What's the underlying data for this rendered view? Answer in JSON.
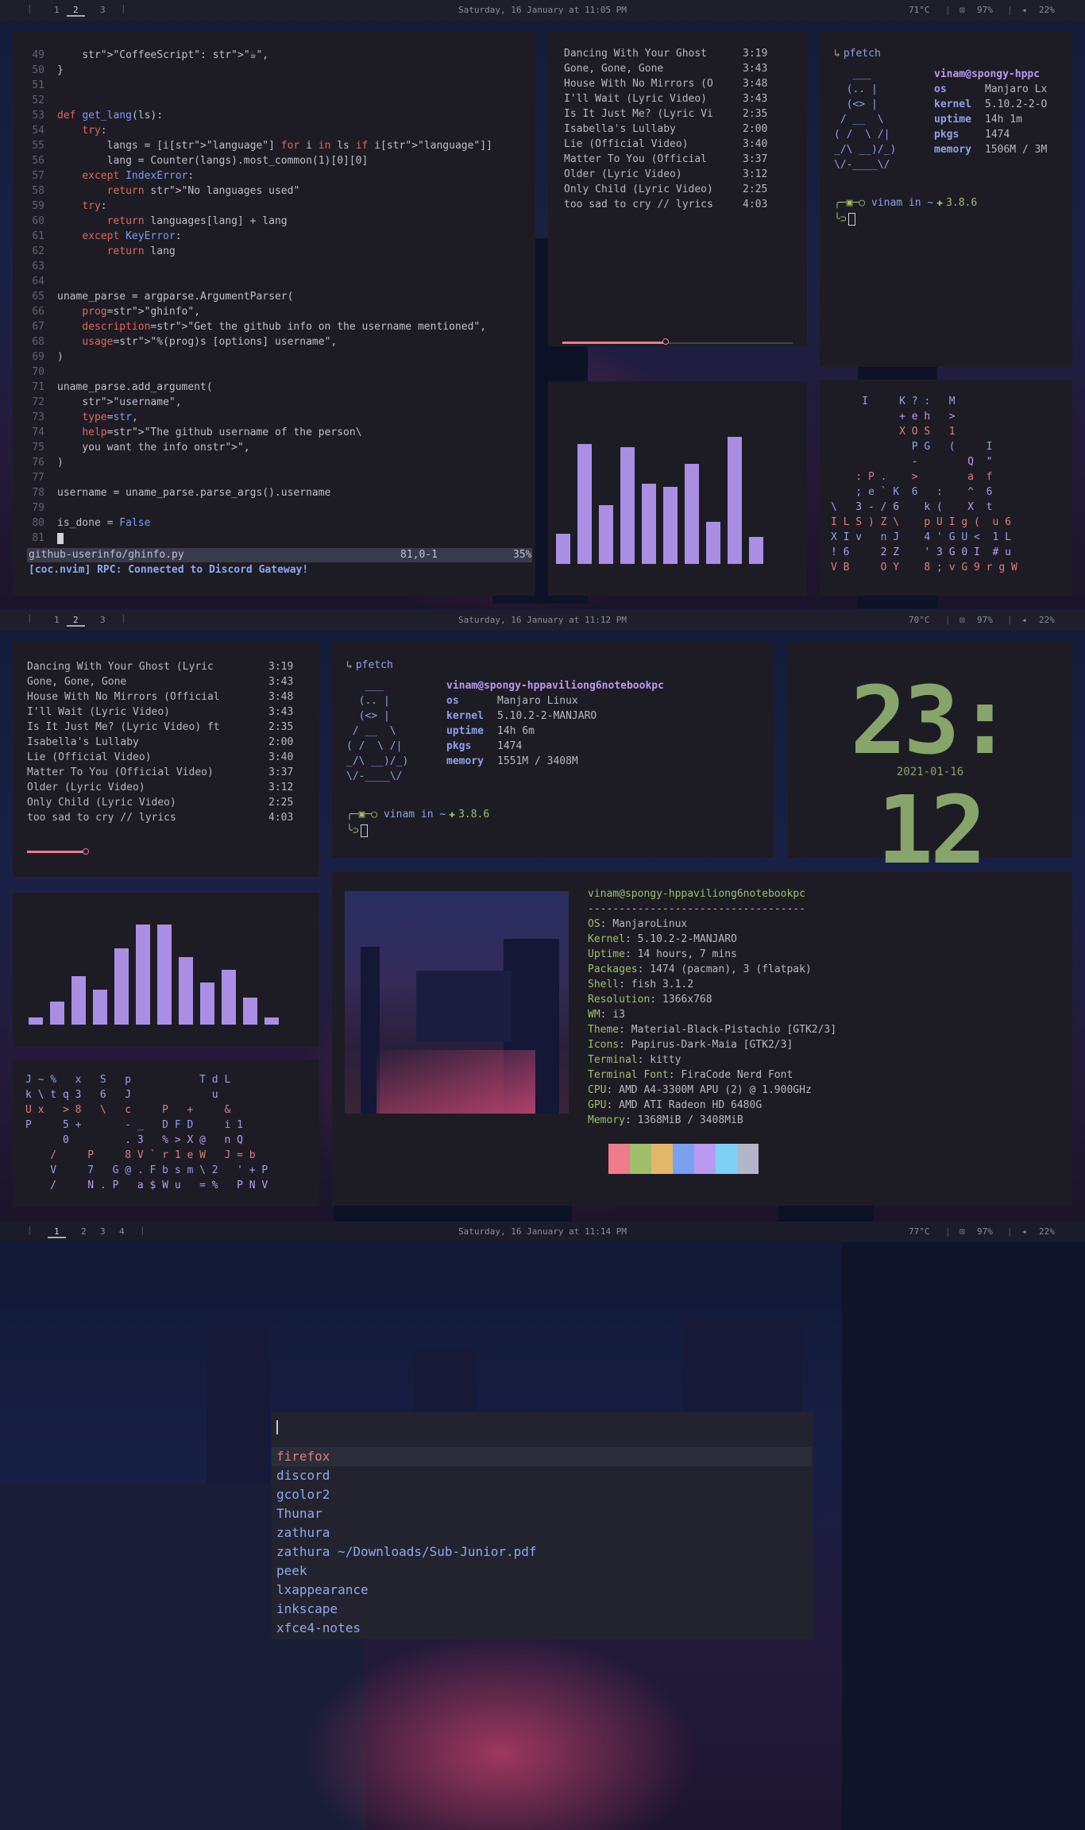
{
  "bars": [
    {
      "workspaces": [
        "1",
        "2",
        "3"
      ],
      "active": "2",
      "clock": "Saturday, 16 January at 11:05 PM",
      "temp": "71°C",
      "battery": "97%",
      "volume": "22%"
    },
    {
      "workspaces": [
        "1",
        "2",
        "3"
      ],
      "active": "2",
      "clock": "Saturday, 16 January at 11:12 PM",
      "temp": "70°C",
      "battery": "97%",
      "volume": "22%"
    },
    {
      "workspaces": [
        "1",
        "2",
        "3",
        "4"
      ],
      "active": "1",
      "clock": "Saturday, 16 January at 11:14 PM",
      "temp": "77°C",
      "battery": "97%",
      "volume": "22%"
    }
  ],
  "editor": {
    "statusline_file": "github-userinfo/ghinfo.py",
    "statusline_pos": "81,0-1",
    "statusline_pct": "35%",
    "message": "[coc.nvim] RPC: Connected to Discord Gateway!",
    "lines": [
      {
        "n": "49",
        "t": "    \"CoffeeScript\": \"☕\","
      },
      {
        "n": "50",
        "t": "}"
      },
      {
        "n": "51",
        "t": ""
      },
      {
        "n": "52",
        "t": ""
      },
      {
        "n": "53",
        "t": "def get_lang(ls):"
      },
      {
        "n": "54",
        "t": "    try:"
      },
      {
        "n": "55",
        "t": "        langs = [i[\"language\"] for i in ls if i[\"language\"]]"
      },
      {
        "n": "56",
        "t": "        lang = Counter(langs).most_common(1)[0][0]"
      },
      {
        "n": "57",
        "t": "    except IndexError:"
      },
      {
        "n": "58",
        "t": "        return \"No languages used\""
      },
      {
        "n": "59",
        "t": "    try:"
      },
      {
        "n": "60",
        "t": "        return languages[lang] + lang"
      },
      {
        "n": "61",
        "t": "    except KeyError:"
      },
      {
        "n": "62",
        "t": "        return lang"
      },
      {
        "n": "63",
        "t": ""
      },
      {
        "n": "64",
        "t": ""
      },
      {
        "n": "65",
        "t": "uname_parse = argparse.ArgumentParser("
      },
      {
        "n": "66",
        "t": "    prog=\"ghinfo\","
      },
      {
        "n": "67",
        "t": "    description=\"Get the github info on the username mentioned\","
      },
      {
        "n": "68",
        "t": "    usage=\"%(prog)s [options] username\","
      },
      {
        "n": "69",
        "t": ")"
      },
      {
        "n": "70",
        "t": ""
      },
      {
        "n": "71",
        "t": "uname_parse.add_argument("
      },
      {
        "n": "72",
        "t": "    \"username\","
      },
      {
        "n": "73",
        "t": "    type=str,"
      },
      {
        "n": "74",
        "t": "    help=\"The github username of the person\\"
      },
      {
        "n": "75",
        "t": "    you want the info on\","
      },
      {
        "n": "76",
        "t": ")"
      },
      {
        "n": "77",
        "t": ""
      },
      {
        "n": "78",
        "t": "username = uname_parse.parse_args().username"
      },
      {
        "n": "79",
        "t": ""
      },
      {
        "n": "80",
        "t": "is_done = False"
      },
      {
        "n": "81",
        "t": ""
      }
    ]
  },
  "playlist_short": [
    {
      "title": "Dancing With Your Ghost",
      "dur": "3:19"
    },
    {
      "title": "Gone, Gone, Gone",
      "dur": "3:43"
    },
    {
      "title": "House With No Mirrors (O",
      "dur": "3:48"
    },
    {
      "title": "I'll Wait (Lyric Video)",
      "dur": "3:43"
    },
    {
      "title": "Is It Just Me? (Lyric Vi",
      "dur": "2:35"
    },
    {
      "title": "Isabella's Lullaby",
      "dur": "2:00"
    },
    {
      "title": "Lie (Official Video)",
      "dur": "3:40"
    },
    {
      "title": "Matter To You (Official",
      "dur": "3:37"
    },
    {
      "title": "Older (Lyric Video)",
      "dur": "3:12"
    },
    {
      "title": "Only Child (Lyric Video)",
      "dur": "2:25"
    },
    {
      "title": "too sad to cry // lyrics",
      "dur": "4:03"
    }
  ],
  "playlist_long": [
    {
      "title": "Dancing With Your Ghost (Lyric",
      "dur": "3:19"
    },
    {
      "title": "Gone, Gone, Gone",
      "dur": "3:43"
    },
    {
      "title": "House With No Mirrors (Official",
      "dur": "3:48"
    },
    {
      "title": "I'll Wait (Lyric Video)",
      "dur": "3:43"
    },
    {
      "title": "Is It Just Me? (Lyric Video) ft",
      "dur": "2:35"
    },
    {
      "title": "Isabella's Lullaby",
      "dur": "2:00"
    },
    {
      "title": "Lie (Official Video)",
      "dur": "3:40"
    },
    {
      "title": "Matter To You (Official Video)",
      "dur": "3:37"
    },
    {
      "title": "Older (Lyric Video)",
      "dur": "3:12"
    },
    {
      "title": "Only Child (Lyric Video)",
      "dur": "2:25"
    },
    {
      "title": "too sad to cry // lyrics",
      "dur": "4:03"
    }
  ],
  "visualizer1": [
    0.18,
    0.72,
    0.35,
    0.7,
    0.48,
    0.46,
    0.6,
    0.25,
    0.76,
    0.16
  ],
  "visualizer2": [
    0.06,
    0.2,
    0.42,
    0.3,
    0.66,
    0.86,
    0.86,
    0.58,
    0.36,
    0.47,
    0.23,
    0.06
  ],
  "pfetch1": {
    "cmd": "pfetch",
    "user": "vinam@spongy-hppc",
    "os": "Manjaro Lx",
    "kernel": "5.10.2-2-O",
    "uptime": "14h 1m",
    "pkgs": "1474",
    "memory": "1506M / 3M",
    "prompt_user": "vinam in ~",
    "python": "3.8.6"
  },
  "pfetch2": {
    "cmd": "pfetch",
    "user": "vinam@spongy-hppaviliong6notebookpc",
    "os": "Manjaro Linux",
    "kernel": "5.10.2-2-MANJARO",
    "uptime": "14h 6m",
    "pkgs": "1474",
    "memory": "1551M / 3408M",
    "prompt_user": "vinam in ~",
    "python": "3.8.6"
  },
  "pfetch_labels": {
    "os": "os",
    "kernel": "kernel",
    "uptime": "uptime",
    "pkgs": "pkgs",
    "memory": "memory"
  },
  "ascii_logo": [
    "   ___",
    "  (.. |",
    "  (<> |",
    " / __  \\",
    "( /  \\ /|",
    "_/\\ __)/_)",
    "\\/-____\\/"
  ],
  "clock": {
    "time": "23: 12",
    "date": "2021-01-16"
  },
  "neofetch": {
    "header": "vinam@spongy-hppaviliong6notebookpc",
    "rule": "-----------------------------------",
    "rows": [
      {
        "k": "OS",
        "v": "ManjaroLinux"
      },
      {
        "k": "Kernel",
        "v": "5.10.2-2-MANJARO"
      },
      {
        "k": "Uptime",
        "v": "14 hours, 7 mins"
      },
      {
        "k": "Packages",
        "v": "1474 (pacman), 3 (flatpak)"
      },
      {
        "k": "Shell",
        "v": "fish 3.1.2"
      },
      {
        "k": "Resolution",
        "v": "1366x768"
      },
      {
        "k": "WM",
        "v": "i3"
      },
      {
        "k": "Theme",
        "v": "Material-Black-Pistachio [GTK2/3]"
      },
      {
        "k": "Icons",
        "v": "Papirus-Dark-Maia [GTK2/3]"
      },
      {
        "k": "Terminal",
        "v": "kitty"
      },
      {
        "k": "Terminal Font",
        "v": "FiraCode Nerd Font"
      },
      {
        "k": "CPU",
        "v": "AMD A4-3300M APU (2) @ 1.900GHz"
      },
      {
        "k": "GPU",
        "v": "AMD ATI Radeon HD 6480G"
      },
      {
        "k": "Memory",
        "v": "1368MiB / 3408MiB"
      }
    ],
    "palette": [
      "#ef7b8c",
      "#9fbf6a",
      "#e3b86d",
      "#7aa0f0",
      "#b99af0",
      "#7fd0f5",
      "#b3b6c8"
    ]
  },
  "rain1": [
    "     I     K ? :   M      ",
    "           + e h   >      ",
    "           X O S   1      ",
    "             P G   (     I",
    "             -        Q  \"",
    "    : P .    >        a  f",
    "    ; e ` K  6   :    ^  6",
    "\\   3 - / 6    k (    X  t",
    "I L S ) Z \\    p U I g (  u 6",
    "X I v   n J    4 ' G U <  1 L",
    "! 6     2 Z    ' 3 G 0 I  # u",
    "V B     O Y    8 ; v G 9 r g W"
  ],
  "rain2": [
    "J ~ %   x   S   p           T d L",
    "k \\ t q 3   6   J             u  ",
    "U x   > 8   \\   c     P   +     &",
    "P     5 +       - _   D F D     i 1",
    "      0         . 3   % > X @   n Q",
    "    /     P     8 V ` r 1 e W   J = b",
    "    V     7   G @ . F b s m \\ 2   ' + P",
    "    /     N . P   a $ W u   = %   P N V"
  ],
  "launcher": {
    "query": "",
    "items": [
      "firefox",
      "discord",
      "gcolor2",
      "Thunar",
      "zathura",
      "zathura ~/Downloads/Sub-Junior.pdf",
      "peek",
      "lxappearance",
      "inkscape",
      "xfce4-notes"
    ],
    "selected": 0
  }
}
